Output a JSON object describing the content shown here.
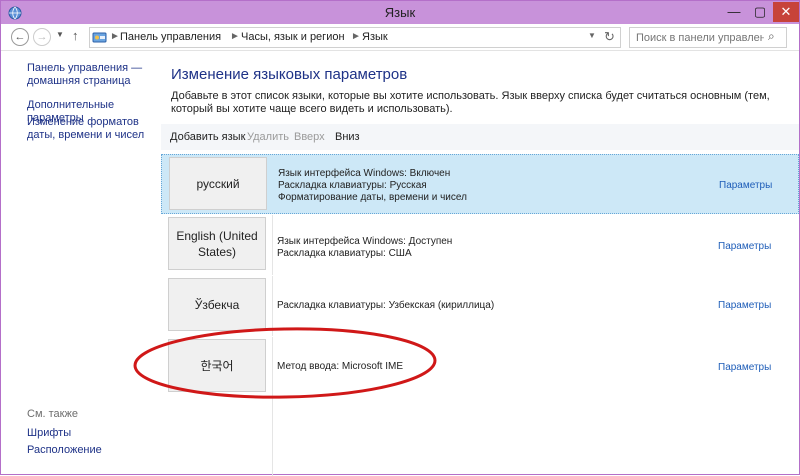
{
  "window": {
    "title": "Язык",
    "minimize": "—",
    "maximize": "▢",
    "close": "✕"
  },
  "nav": {
    "back": "←",
    "forward": "→",
    "recent": "▼",
    "up": "↑"
  },
  "address": {
    "crumbs": [
      "Панель управления",
      "Часы, язык и регион",
      "Язык"
    ],
    "separator": "►",
    "dropdown": "▼",
    "refresh": "↻"
  },
  "search": {
    "placeholder": "Поиск в панели управления",
    "icon": "⌕"
  },
  "sidebar": {
    "links": [
      "Панель управления — домашняя страница",
      "Дополнительные параметры",
      "Изменение форматов даты, времени и чисел"
    ],
    "see_also": "См. также",
    "see_also_links": [
      "Шрифты",
      "Расположение"
    ]
  },
  "main": {
    "title": "Изменение языковых параметров",
    "description": "Добавьте в этот список языки, которые вы хотите использовать. Язык вверху списка будет считаться основным (тем, который вы хотите чаще всего видеть и использовать).",
    "commands": {
      "add": "Добавить язык",
      "remove": "Удалить",
      "up": "Вверх",
      "down": "Вниз"
    },
    "languages": [
      {
        "name": "русский",
        "details": [
          "Язык интерфейса Windows: Включен",
          "Раскладка клавиатуры: Русская",
          "Форматирование даты, времени и чисел"
        ],
        "options": "Параметры",
        "selected": true
      },
      {
        "name": "English (United States)",
        "details": [
          "Язык интерфейса Windows: Доступен",
          "Раскладка клавиатуры: США"
        ],
        "options": "Параметры",
        "selected": false
      },
      {
        "name": "Ўзбекча",
        "details": [
          "Раскладка клавиатуры: Узбекская (кириллица)"
        ],
        "options": "Параметры",
        "selected": false
      },
      {
        "name": "한국어",
        "details": [
          "Метод ввода: Microsoft IME"
        ],
        "options": "Параметры",
        "selected": false
      }
    ]
  },
  "colors": {
    "titlebar": "#c892da",
    "selected_row": "#cde8f7",
    "link": "#1e3287",
    "annotation": "#d01818"
  },
  "icons": {
    "app": "globe-icon",
    "control_panel": "control-panel-icon",
    "search": "search-icon",
    "refresh": "refresh-icon"
  }
}
